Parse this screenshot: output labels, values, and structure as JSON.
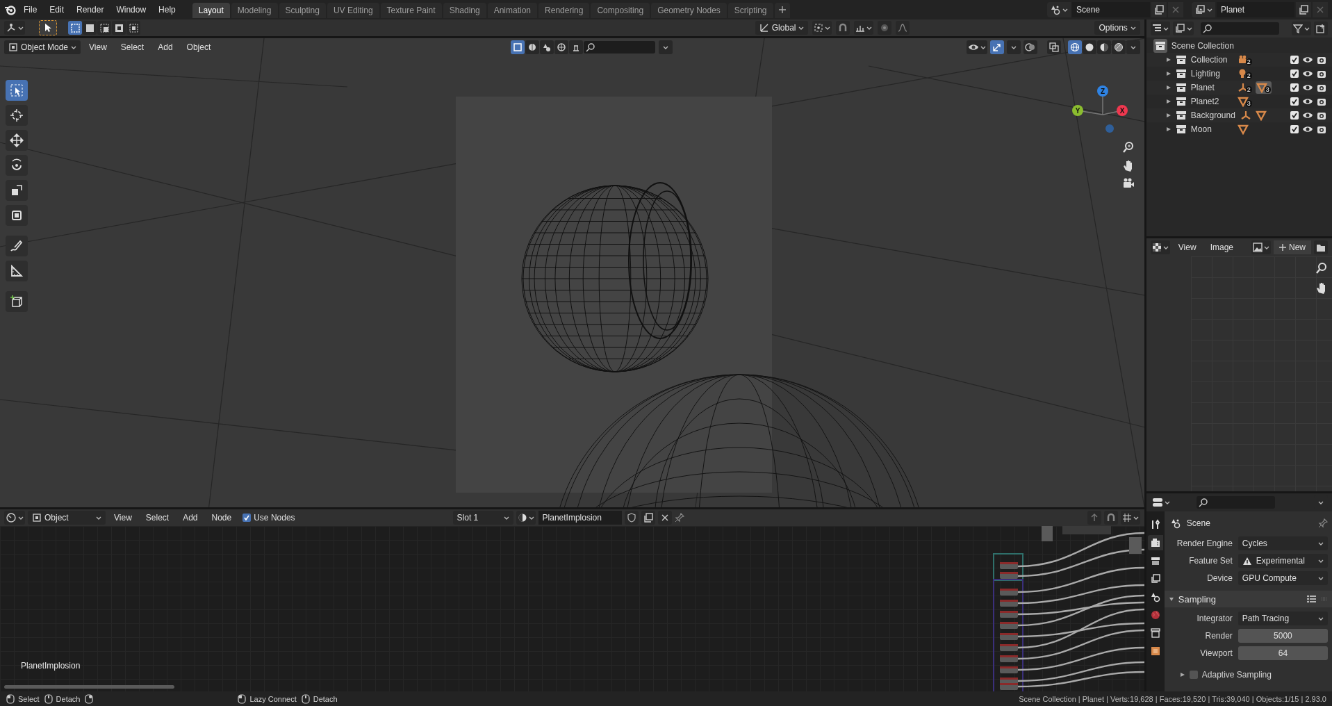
{
  "menu": [
    "File",
    "Edit",
    "Render",
    "Window",
    "Help"
  ],
  "workspaces": [
    {
      "label": "Layout",
      "selected": true
    },
    {
      "label": "Modeling",
      "selected": false
    },
    {
      "label": "Sculpting",
      "selected": false
    },
    {
      "label": "UV Editing",
      "selected": false
    },
    {
      "label": "Texture Paint",
      "selected": false
    },
    {
      "label": "Shading",
      "selected": false
    },
    {
      "label": "Animation",
      "selected": false
    },
    {
      "label": "Rendering",
      "selected": false
    },
    {
      "label": "Compositing",
      "selected": false
    },
    {
      "label": "Geometry Nodes",
      "selected": false
    },
    {
      "label": "Scripting",
      "selected": false
    }
  ],
  "scene": "Scene",
  "view_layer": "Planet",
  "tool_header": {
    "select_modes": [
      {
        "selected": true
      },
      {
        "selected": false
      },
      {
        "selected": false
      },
      {
        "selected": false
      },
      {
        "selected": false
      }
    ],
    "orientation": "Global",
    "options": "Options"
  },
  "viewport": {
    "mode": "Object Mode",
    "menus": [
      "View",
      "Select",
      "Add",
      "Object"
    ],
    "shading": [
      {
        "kind": "wireframe",
        "selected": true
      },
      {
        "kind": "solid",
        "selected": false
      },
      {
        "kind": "material",
        "selected": false
      },
      {
        "kind": "rendered",
        "selected": false
      }
    ],
    "tools": [
      {
        "kind": "select",
        "selected": true
      },
      {
        "kind": "cursor",
        "selected": false
      },
      {
        "kind": "move",
        "selected": false
      },
      {
        "kind": "rotate",
        "selected": false
      },
      {
        "kind": "scale",
        "selected": false
      },
      {
        "kind": "transform",
        "selected": false
      },
      {
        "kind": "annotate",
        "selected": false
      },
      {
        "kind": "measure",
        "selected": false
      },
      {
        "kind": "add-cube",
        "selected": false
      }
    ],
    "gizmo": [
      {
        "kind": "z",
        "label": "Z"
      },
      {
        "kind": "y",
        "label": "Y"
      },
      {
        "kind": "x",
        "label": "X"
      },
      {
        "kind": "neg-z"
      }
    ]
  },
  "outliner": {
    "root": "Scene Collection",
    "items": [
      {
        "label": "Collection",
        "checked": true,
        "icons": [
          {
            "kind": "camera",
            "count": "2",
            "active": false
          }
        ]
      },
      {
        "label": "Lighting",
        "checked": true,
        "icons": [
          {
            "kind": "light",
            "count": "2",
            "active": false
          }
        ]
      },
      {
        "label": "Planet",
        "checked": true,
        "icons": [
          {
            "kind": "empty",
            "count": "2",
            "active": false
          },
          {
            "kind": "mesh",
            "count": "3",
            "active": true
          }
        ]
      },
      {
        "label": "Planet2",
        "checked": true,
        "icons": [
          {
            "kind": "mesh",
            "count": "3",
            "active": false
          }
        ]
      },
      {
        "label": "Background",
        "checked": true,
        "icons": [
          {
            "kind": "empty",
            "active": false
          },
          {
            "kind": "mesh",
            "active": false
          }
        ]
      },
      {
        "label": "Moon",
        "checked": true,
        "icons": [
          {
            "kind": "mesh",
            "active": false
          }
        ]
      }
    ]
  },
  "image_editor": {
    "menus": [
      "View",
      "Image"
    ],
    "new_button": "New"
  },
  "node_editor": {
    "type": "Object",
    "menus": [
      "View",
      "Select",
      "Add",
      "Node"
    ],
    "use_nodes": {
      "label": "Use Nodes",
      "checked": true
    },
    "slot": "Slot 1",
    "material": "PlanetImplosion",
    "frame_label": "PlanetImplosion"
  },
  "properties": {
    "tabs": [
      {
        "kind": "tool",
        "selected": false
      },
      {
        "kind": "render",
        "selected": true
      },
      {
        "kind": "output",
        "selected": false
      },
      {
        "kind": "view-layer",
        "selected": false
      },
      {
        "kind": "scene",
        "selected": false
      },
      {
        "kind": "world",
        "selected": false
      },
      {
        "kind": "collection",
        "selected": false
      },
      {
        "kind": "object",
        "selected": false
      }
    ],
    "context": "Scene",
    "fields": [
      {
        "label": "Render Engine",
        "value": "Cycles",
        "kind": "dropdown",
        "warning": false
      },
      {
        "label": "Feature Set",
        "value": "Experimental",
        "kind": "dropdown",
        "warning": true
      },
      {
        "label": "Device",
        "value": "GPU Compute",
        "kind": "dropdown",
        "warning": false
      }
    ],
    "sections": [
      {
        "label": "Sampling",
        "expanded": true,
        "fields": [
          {
            "label": "Integrator",
            "value": "Path Tracing",
            "kind": "dropdown",
            "warning": false
          },
          {
            "label": "Render",
            "value": "5000",
            "kind": "number",
            "warning": false
          },
          {
            "label": "Viewport",
            "value": "64",
            "kind": "number",
            "warning": false
          }
        ],
        "subpanels": [
          {
            "label": "Adaptive Sampling",
            "expanded": false,
            "checked": false
          }
        ]
      }
    ]
  },
  "status_bar": {
    "groups": [
      [
        {
          "kind": "mouse-left",
          "label": "Select"
        },
        {
          "kind": "mouse-middle",
          "label": "Detach"
        },
        {
          "kind": "mouse-right"
        }
      ],
      [
        {
          "kind": "mouse-left",
          "label": "Lazy Connect"
        },
        {
          "kind": "mouse-middle",
          "label": "Detach"
        }
      ]
    ],
    "info": "Scene Collection | Planet | Verts:19,628 | Faces:19,520 | Tris:39,040 | Objects:1/15 | 2.93.0"
  }
}
